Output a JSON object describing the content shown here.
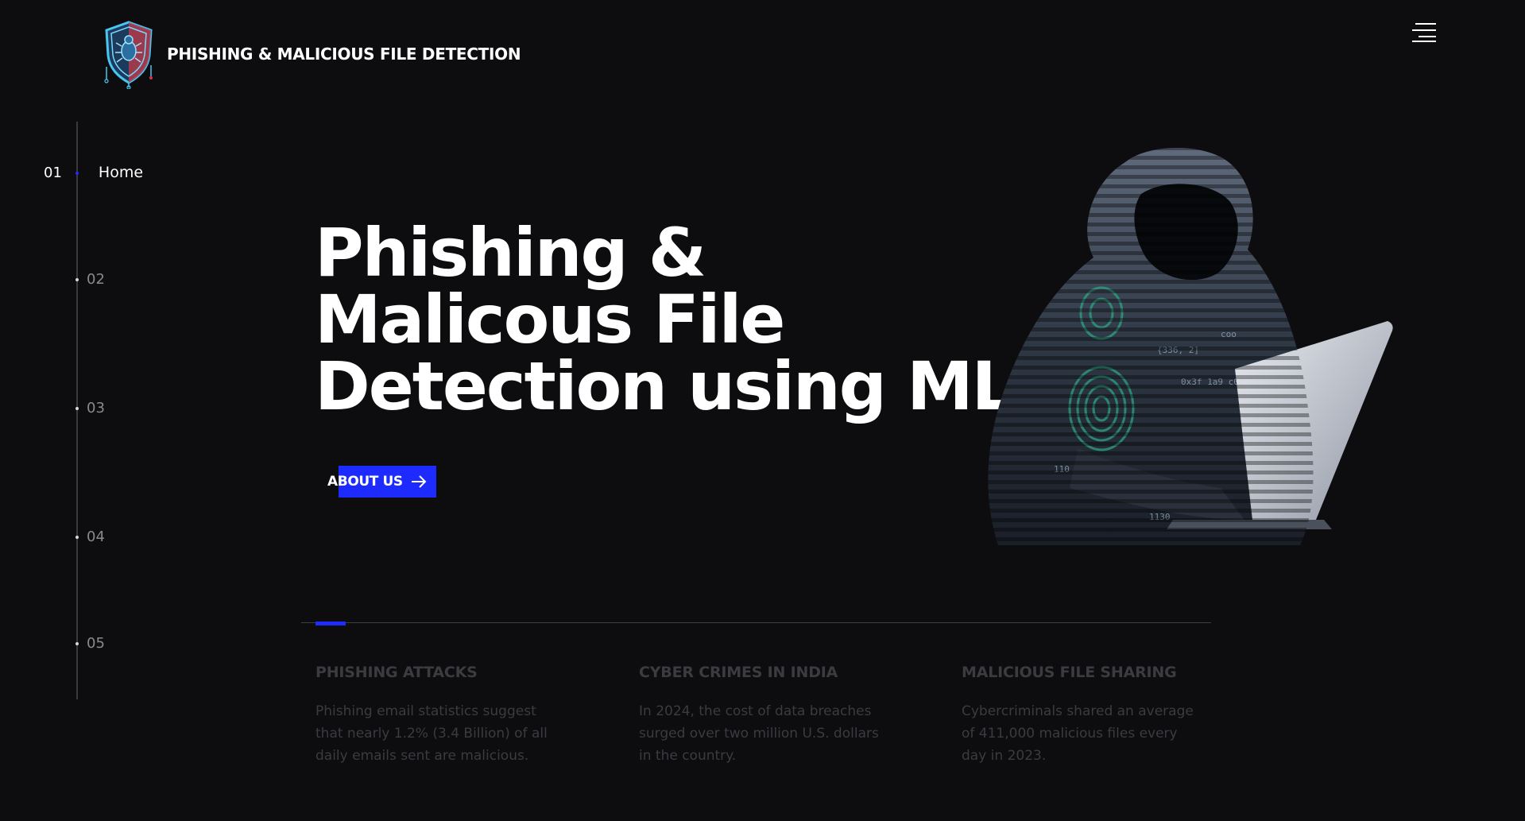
{
  "header": {
    "title": "PHISHING & MALICIOUS FILE DETECTION",
    "menu_icon": "hamburger-menu-icon"
  },
  "sidebar": {
    "items": [
      {
        "number": "01",
        "label": "Home",
        "active": true
      },
      {
        "number": "02",
        "label": "",
        "active": false
      },
      {
        "number": "03",
        "label": "",
        "active": false
      },
      {
        "number": "04",
        "label": "",
        "active": false
      },
      {
        "number": "05",
        "label": "",
        "active": false
      }
    ]
  },
  "hero": {
    "title_line1": "Phishing &",
    "title_line2": "Malicous File",
    "title_line3": "Detection using ML",
    "button_label": "ABOUT US",
    "button_icon": "arrow-right-icon"
  },
  "stats": [
    {
      "title": "PHISHING ATTACKS",
      "text": "Phishing email statistics suggest that nearly 1.2% (3.4 Billion) of all daily emails sent are malicious."
    },
    {
      "title": "CYBER CRIMES IN INDIA",
      "text": "In 2024, the cost of data breaches surged over two million U.S. dollars in the country."
    },
    {
      "title": "MALICIOUS FILE SHARING",
      "text": "Cybercriminals shared an average of 411,000 malicious files every day in 2023."
    }
  ],
  "colors": {
    "background": "#0d0d0f",
    "accent": "#1e2bff",
    "muted_text": "#3b3b40"
  }
}
